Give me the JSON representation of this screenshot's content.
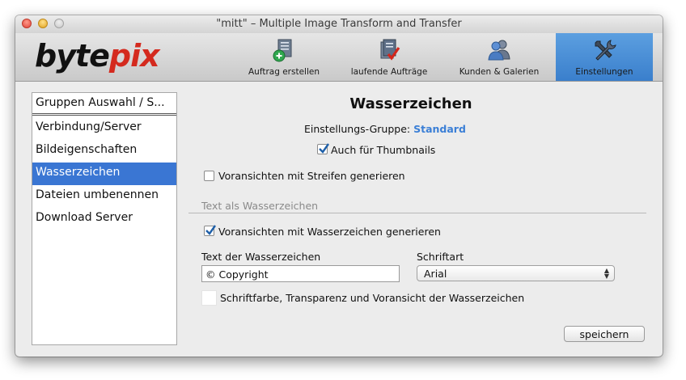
{
  "window": {
    "title": "\"mitt\" – Multiple Image Transform and Transfer"
  },
  "logo": {
    "part1": "byte",
    "part2": "pix"
  },
  "toolbar": {
    "items": [
      {
        "label": "Auftrag erstellen",
        "icon": "document-add-icon",
        "active": false
      },
      {
        "label": "laufende Aufträge",
        "icon": "document-check-icon",
        "active": false
      },
      {
        "label": "Kunden & Galerien",
        "icon": "users-icon",
        "active": false
      },
      {
        "label": "Einstellungen",
        "icon": "tools-icon",
        "active": true
      }
    ]
  },
  "sidebar": {
    "header": "Gruppen Auswahl / S...",
    "items": [
      {
        "label": "Verbindung/Server",
        "selected": false
      },
      {
        "label": "Bildeigenschaften",
        "selected": false
      },
      {
        "label": "Wasserzeichen",
        "selected": true
      },
      {
        "label": "Dateien umbenennen",
        "selected": false
      },
      {
        "label": "Download Server",
        "selected": false
      }
    ]
  },
  "main": {
    "title": "Wasserzeichen",
    "group_label": "Einstellungs-Gruppe:",
    "group_value": "Standard",
    "thumbnails_checkbox": {
      "label": "Auch für Thumbnails",
      "checked": true
    },
    "stripes_checkbox": {
      "label": "Voransichten mit Streifen generieren",
      "checked": false
    },
    "section_label": "Text als Wasserzeichen",
    "watermark_checkbox": {
      "label": "Voransichten mit Wasserzeichen generieren",
      "checked": true
    },
    "text_field": {
      "label": "Text der Wasserzeichen",
      "value": "© Copyright"
    },
    "font_select": {
      "label": "Schriftart",
      "value": "Arial"
    },
    "color_label": "Schriftfarbe, Transparenz und Voransicht der Wasserzeichen",
    "save_button": "speichern"
  },
  "colors": {
    "accent": "#3a76d3",
    "logo_red": "#d42a1e",
    "group_value": "#3b7fd6",
    "toolbar_active": "#4a8fd8"
  }
}
